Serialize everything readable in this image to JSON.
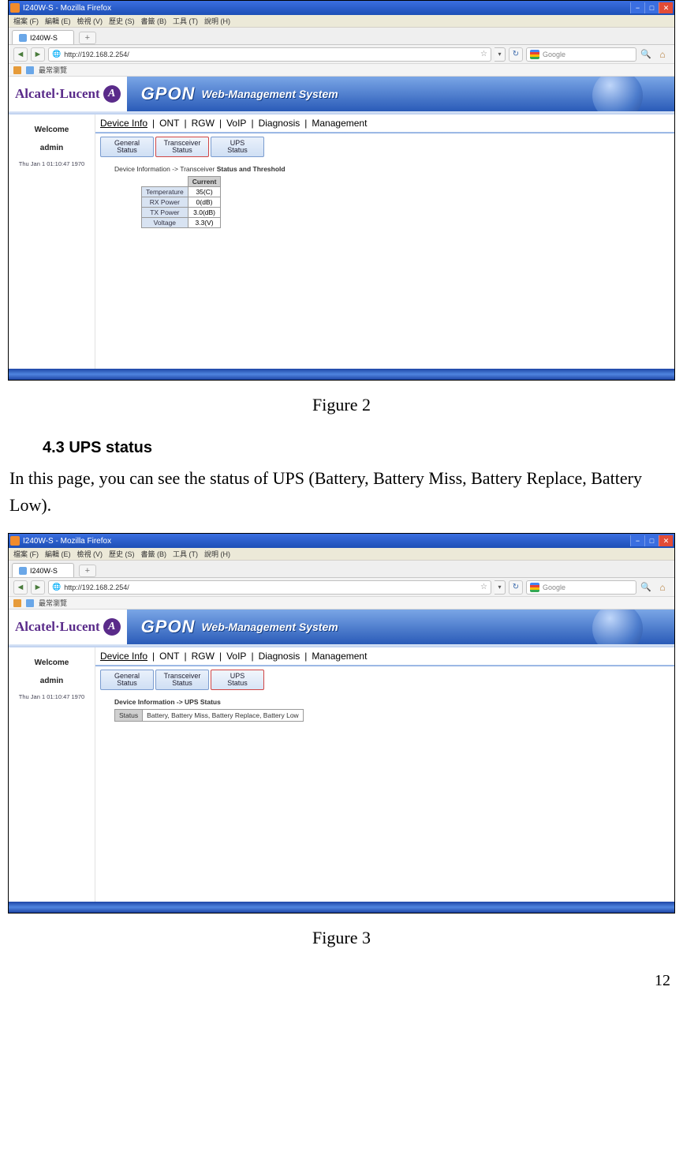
{
  "ff_title": "I240W-S - Mozilla Firefox",
  "ff_menus": [
    "檔案 (F)",
    "編輯 (E)",
    "檢視 (V)",
    "歷史 (S)",
    "書籤 (B)",
    "工具 (T)",
    "說明 (H)"
  ],
  "tab_label": "I240W-S",
  "url": "http://192.168.2.254/",
  "search_placeholder": "Google",
  "bookmark_label": "最常瀏覽",
  "brand": "Alcatel·Lucent",
  "gpon": "GPON",
  "wms": "Web-Management System",
  "welcome": "Welcome",
  "user": "admin",
  "datetime": "Thu Jan 1 01:10:47 1970",
  "ptabs": [
    "Device Info",
    "ONT",
    "RGW",
    "VoIP",
    "Diagnosis",
    "Management"
  ],
  "subtabs": [
    {
      "l1": "General",
      "l2": "Status"
    },
    {
      "l1": "Transceiver",
      "l2": "Status"
    },
    {
      "l1": "UPS",
      "l2": "Status"
    }
  ],
  "fig2": {
    "breadcrumb_pre": "Device Information -> Transceiver ",
    "breadcrumb_b": "Status and Threshold",
    "head": "Current",
    "rows": [
      {
        "lab": "Temperature",
        "val": "35(C)"
      },
      {
        "lab": "RX Power",
        "val": "0(dB)"
      },
      {
        "lab": "TX Power",
        "val": "3.0(dB)"
      },
      {
        "lab": "Voltage",
        "val": "3.3(V)"
      }
    ],
    "caption": "Figure 2"
  },
  "section_head": "4.3    UPS status",
  "body_text": "In this page, you can see the status of UPS (Battery, Battery Miss, Battery Replace, Battery Low).",
  "fig3": {
    "breadcrumb": "Device Information -> UPS Status",
    "lab": "Status",
    "val": "Battery, Battery Miss, Battery Replace, Battery Low",
    "caption": "Figure 3"
  },
  "page_number": "12"
}
